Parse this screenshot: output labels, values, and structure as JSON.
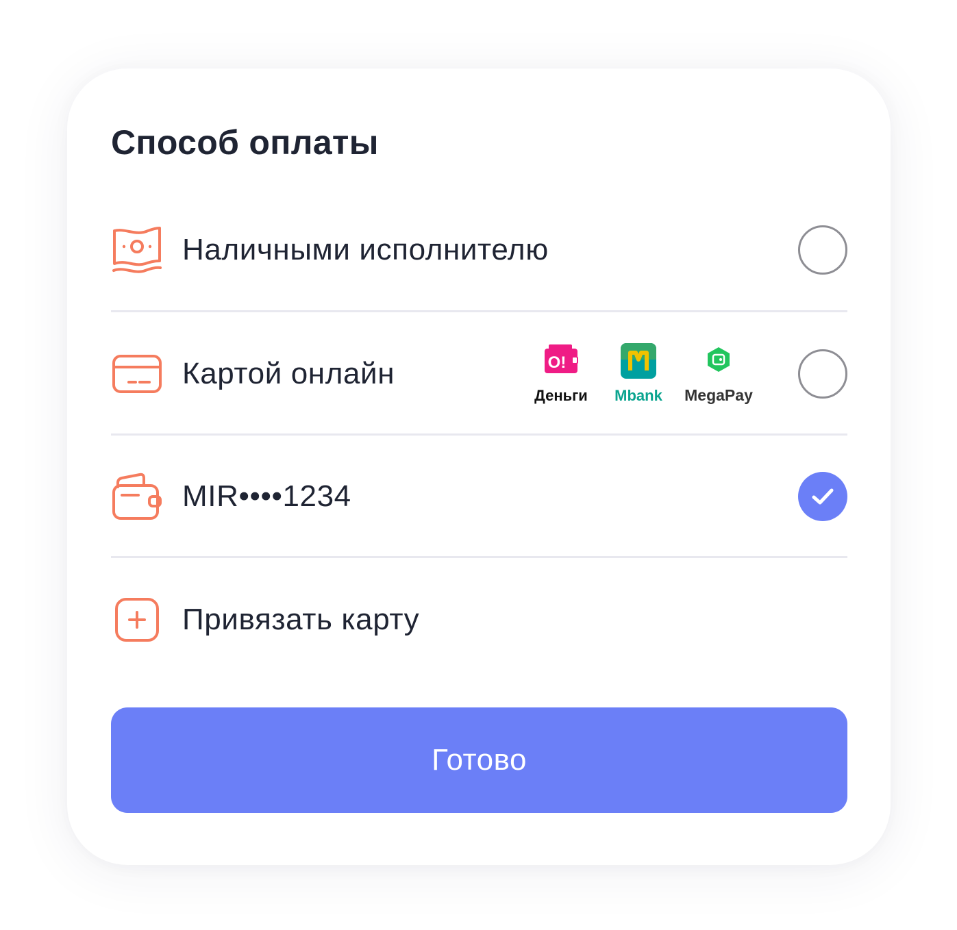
{
  "title": "Способ оплаты",
  "accent_color": "#6b7ff7",
  "icon_color": "#f57c5e",
  "options": [
    {
      "icon": "cash-icon",
      "label": "Наличными исполнителю",
      "selected": false
    },
    {
      "icon": "card-icon",
      "label": "Картой онлайн",
      "selected": false,
      "brands": [
        {
          "logo_text": "O!",
          "name": "Деньги",
          "color": "#ef1c85"
        },
        {
          "logo_text": "M",
          "name": "Mbank",
          "color": "#00a0a0"
        },
        {
          "logo_text": "",
          "name": "MegaPay",
          "color": "#22c55e"
        }
      ]
    },
    {
      "icon": "wallet-icon",
      "label": "MIR••••1234",
      "selected": true
    },
    {
      "icon": "plus-square-icon",
      "label": "Привязать карту"
    }
  ],
  "button": {
    "label": "Готово"
  }
}
